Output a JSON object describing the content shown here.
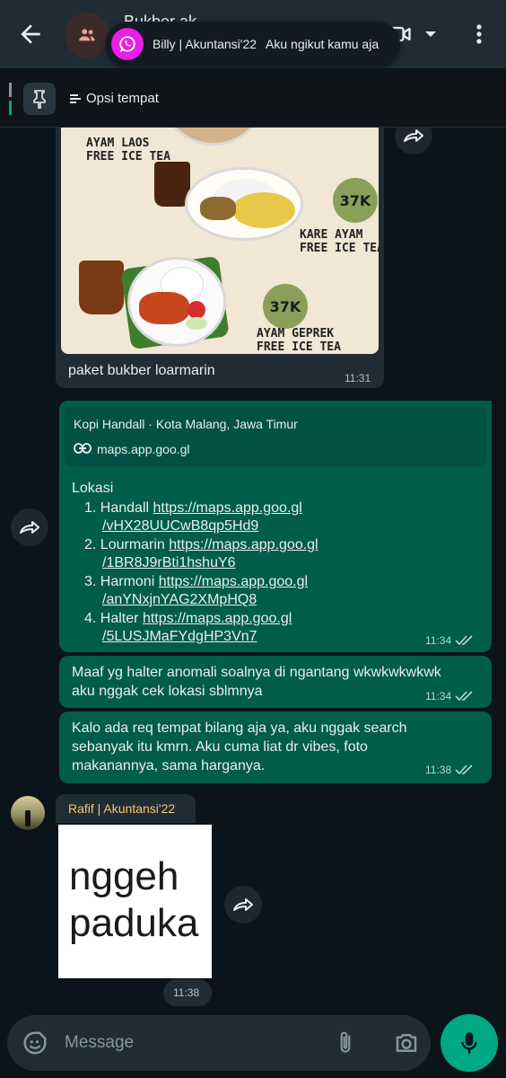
{
  "header": {
    "title": "Bukber ak",
    "toast_name": "Billy | Akuntansi'22",
    "toast_message": "Aku ngikut kamu aja"
  },
  "pinned": {
    "label": "Opsi tempat"
  },
  "messages": {
    "image_caption": "paket bukber loarmarin",
    "image_time": "11:31",
    "menu_items": {
      "item1": "AYAM LAOS\nFREE ICE TEA",
      "item2": "KARE AYAM\nFREE ICE TEA",
      "item3": "AYAM GEPREK\nFREE ICE TEA",
      "price2": "37K",
      "price3": "37K"
    },
    "link_preview_title": "Kopi Handall · Kota Malang, Jawa Timur",
    "link_preview_domain": "maps.app.goo.gl",
    "location_header": "Lokasi",
    "locations": [
      {
        "num": "1.",
        "name": "Handall",
        "url1": "https://maps.app.goo.gl",
        "url2": "/vHX28UUCwB8qp5Hd9"
      },
      {
        "num": "2.",
        "name": "Lourmarin",
        "url1": "https://maps.app.goo.gl",
        "url2": "/1BR8J9rBti1hshuY6"
      },
      {
        "num": "3.",
        "name": "Harmoni",
        "url1": "https://maps.app.goo.gl",
        "url2": "/anYNxjnYAG2XMpHQ8"
      },
      {
        "num": "4.",
        "name": "Halter",
        "url1": "https://maps.app.goo.gl",
        "url2": "/5LUSJMaFYdgHP3Vn7"
      }
    ],
    "location_time": "11:34",
    "msg2_line1": "Maaf yg halter anomali soalnya di ngantang wkwkwkwkwk",
    "msg2_line2": "aku nggak cek lokasi sblmnya",
    "msg2_time": "11:34",
    "msg3_line1": "Kalo ada req tempat bilang aja ya, aku nggak search",
    "msg3_line2": "sebanyak itu kmrn. Aku cuma liat dr vibes, foto",
    "msg3_line3": "makanannya, sama harganya.",
    "msg3_time": "11:38",
    "sender_name": "Rafif | Akuntansi'22",
    "sticker_line1": "nggeh",
    "sticker_line2": "paduka",
    "sticker_time": "11:38"
  },
  "composer": {
    "placeholder": "Message"
  },
  "colors": {
    "accent": "#00a884",
    "outgoing": "#005c4b",
    "incoming": "#1f2c34",
    "sender_name": "#f5c76e"
  }
}
